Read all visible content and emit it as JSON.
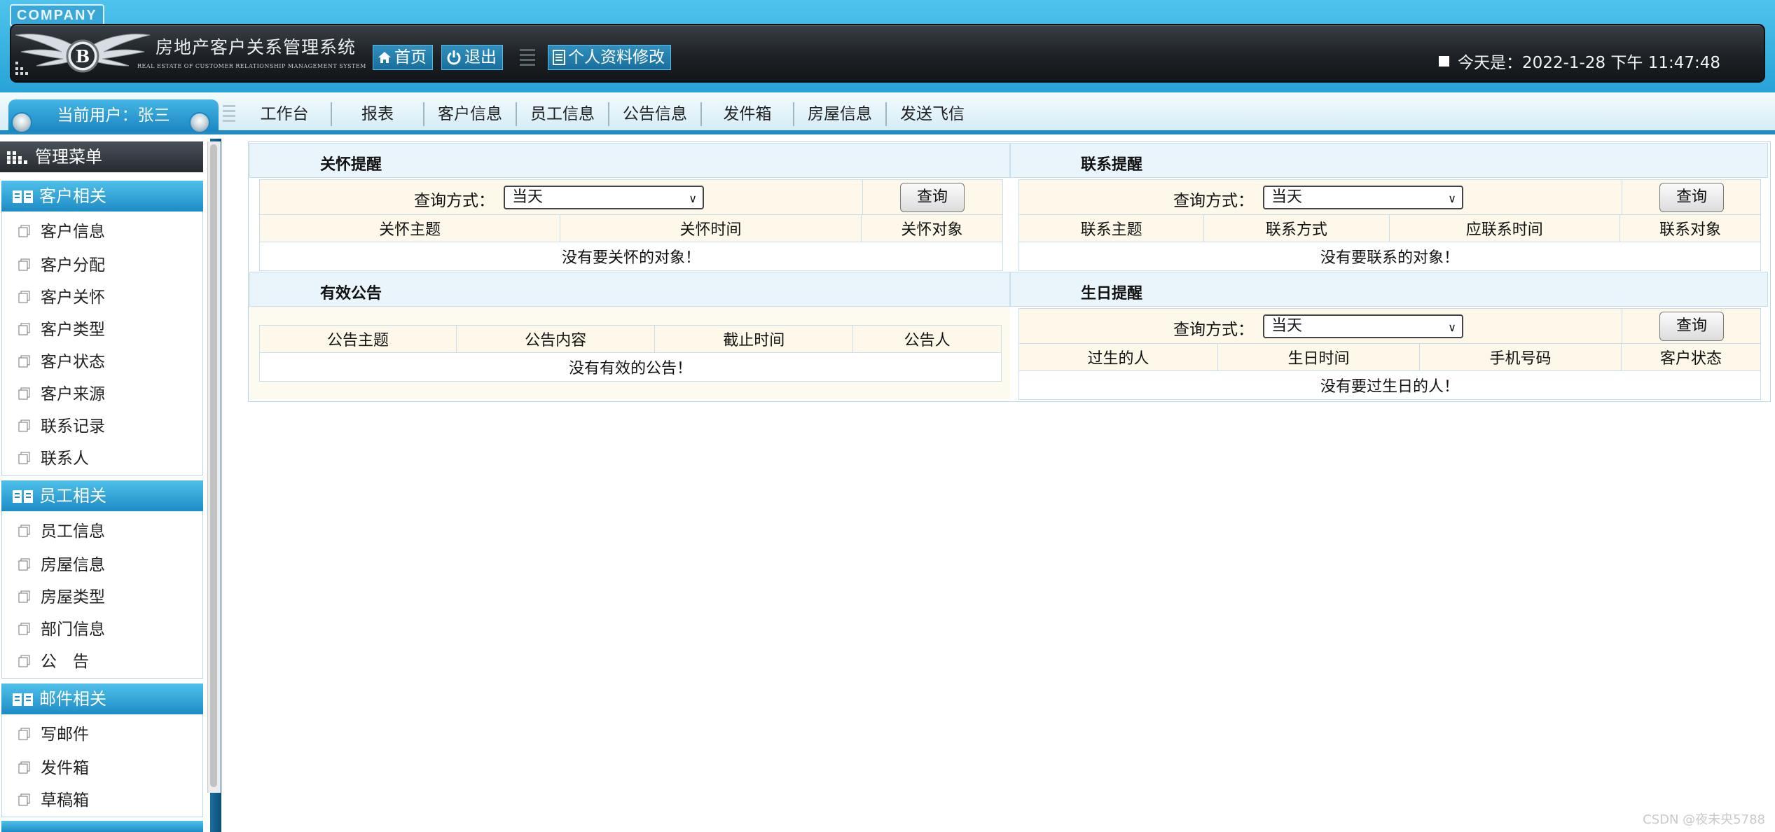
{
  "header": {
    "company_badge": "COMPANY",
    "system_title": "房地产客户关系管理系统",
    "system_subtitle": "REAL ESTATE OF CUSTOMER RELATIONSHIP MANAGEMENT SYSTEM",
    "buttons": {
      "home": "首页",
      "logout": "退出",
      "profile": "个人资料修改"
    },
    "today_label": "今天是：",
    "today_value": "2022-1-28 下午 11:47:48"
  },
  "nav": {
    "current_user": "当前用户：张三",
    "items": [
      "工作台",
      "报表",
      "客户信息",
      "员工信息",
      "公告信息",
      "发件箱",
      "房屋信息",
      "发送飞信"
    ]
  },
  "sidebar": {
    "title": "管理菜单",
    "groups": [
      {
        "title": "客户相关",
        "items": [
          "客户信息",
          "客户分配",
          "客户关怀",
          "客户类型",
          "客户状态",
          "客户来源",
          "联系记录",
          "联系人"
        ]
      },
      {
        "title": "员工相关",
        "items": [
          "员工信息",
          "房屋信息",
          "房屋类型",
          "部门信息",
          "公　告"
        ]
      },
      {
        "title": "邮件相关",
        "items": [
          "写邮件",
          "发件箱",
          "草稿箱"
        ]
      }
    ]
  },
  "panels": {
    "care": {
      "title": "关怀提醒",
      "query_label": "查询方式：",
      "query_value": "当天",
      "query_button": "查询",
      "columns": [
        "关怀主题",
        "关怀时间",
        "关怀对象"
      ],
      "empty": "没有要关怀的对象！"
    },
    "contact": {
      "title": "联系提醒",
      "query_label": "查询方式：",
      "query_value": "当天",
      "query_button": "查询",
      "columns": [
        "联系主题",
        "联系方式",
        "应联系时间",
        "联系对象"
      ],
      "empty": "没有要联系的对象！"
    },
    "notice": {
      "title": "有效公告",
      "columns": [
        "公告主题",
        "公告内容",
        "截止时间",
        "公告人"
      ],
      "empty": "没有有效的公告！"
    },
    "birthday": {
      "title": "生日提醒",
      "query_label": "查询方式：",
      "query_value": "当天",
      "query_button": "查询",
      "columns": [
        "过生的人",
        "生日时间",
        "手机号码",
        "客户状态"
      ],
      "empty": "没有要过生日的人！"
    }
  },
  "watermark": "CSDN @夜未央5788"
}
